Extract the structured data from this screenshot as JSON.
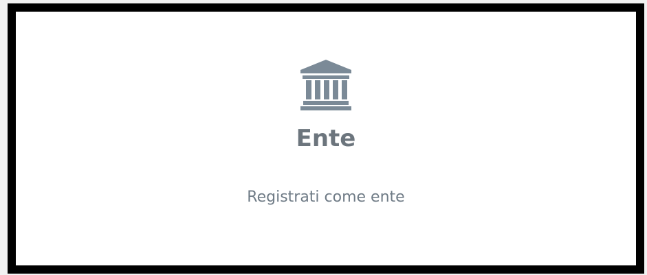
{
  "card": {
    "icon": "bank-building-icon",
    "title": "Ente",
    "subtitle": "Registrati come ente"
  },
  "colors": {
    "icon": "#7b8a97",
    "title": "#6c757d",
    "subtitle": "#6f7b86",
    "border": "#000000",
    "background": "#ffffff"
  }
}
